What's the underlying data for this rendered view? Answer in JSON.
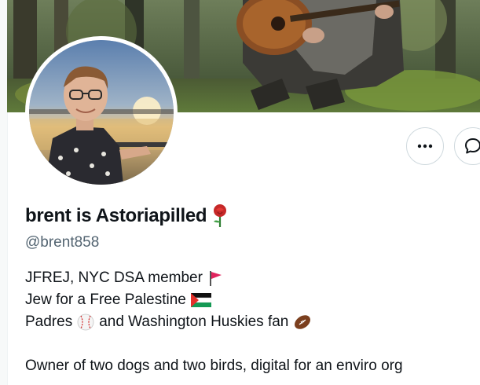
{
  "profile": {
    "display_name": "brent is Astoriapilled",
    "handle": "@brent858",
    "bio_lines": [
      {
        "text": "JFREJ, NYC DSA member",
        "emoji": "red-flag-icon"
      },
      {
        "text": "Jew for a Free Palestine",
        "emoji": "palestine-flag-icon"
      },
      {
        "text": "Padres",
        "mid_emoji": "baseball-icon",
        "text2": "and Washington Huskies fan",
        "emoji": "football-icon"
      },
      {
        "text": "Owner of two dogs and two birds, digital for an enviro org"
      }
    ],
    "name_emoji": "rose-icon"
  },
  "actions": {
    "more_icon": "more-horizontal-icon",
    "message_icon": "message-icon"
  },
  "colors": {
    "text_primary": "#0f1419",
    "text_secondary": "#536471",
    "border": "#cfd9de"
  }
}
